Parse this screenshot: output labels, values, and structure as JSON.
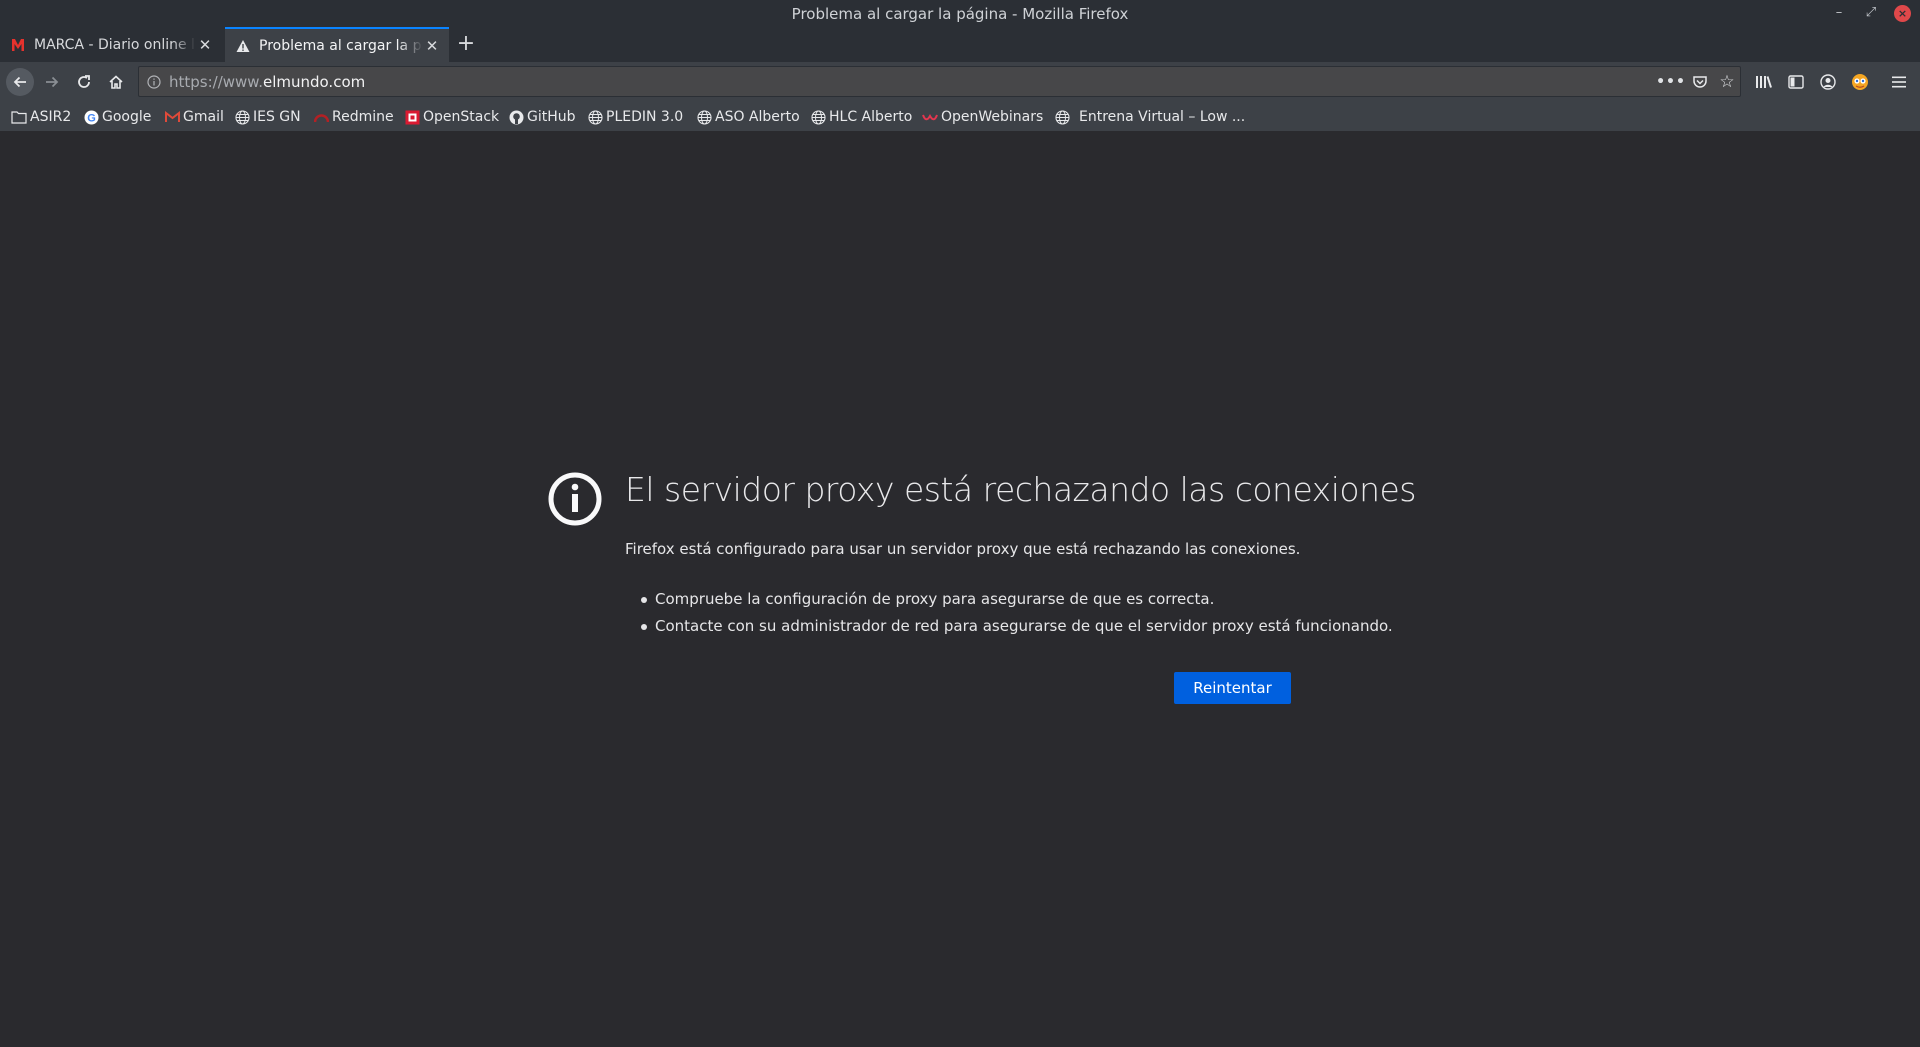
{
  "window": {
    "title": "Problema al cargar la página - Mozilla Firefox"
  },
  "tabs": [
    {
      "label": "MARCA - Diario online líder",
      "icon": "marca-favicon",
      "active": false
    },
    {
      "label": "Problema al cargar la página",
      "icon": "warning-icon",
      "active": true
    }
  ],
  "navbar": {
    "url_prefix": "https://www.",
    "url_domain": "elmundo.com"
  },
  "bookmarks": [
    {
      "label": "ASIR2",
      "icon": "folder-icon"
    },
    {
      "label": "Google",
      "icon": "google-icon"
    },
    {
      "label": "Gmail",
      "icon": "gmail-icon"
    },
    {
      "label": "IES GN",
      "icon": "globe-icon"
    },
    {
      "label": "Redmine",
      "icon": "redmine-icon"
    },
    {
      "label": "OpenStack",
      "icon": "openstack-icon"
    },
    {
      "label": "GitHub",
      "icon": "github-icon"
    },
    {
      "label": "PLEDIN 3.0",
      "icon": "globe-icon"
    },
    {
      "label": "ASO Alberto",
      "icon": "globe-icon"
    },
    {
      "label": "HLC Alberto",
      "icon": "globe-icon"
    },
    {
      "label": "OpenWebinars",
      "icon": "openwebinars-icon"
    },
    {
      "label": "Entrena Virtual – Low ...",
      "icon": "globe-icon"
    }
  ],
  "error": {
    "title": "El servidor proxy está rechazando las conexiones",
    "description": "Firefox está configurado para usar un servidor proxy que está rechazando las conexiones.",
    "suggestions": [
      "Compruebe la configuración de proxy para asegurarse de que es correcta.",
      "Contacte con su administrador de red para asegurarse de que el servidor proxy está funcionando."
    ],
    "retry_label": "Reintentar"
  },
  "colors": {
    "page_background": "#2a2a2e",
    "accent_button": "#0060df",
    "active_tab_line": "#0a84ff"
  }
}
